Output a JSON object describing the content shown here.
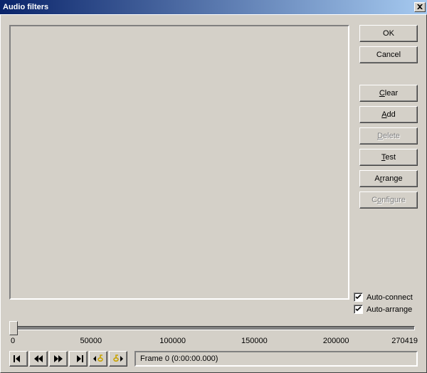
{
  "window": {
    "title": "Audio filters"
  },
  "buttons": {
    "ok": "OK",
    "cancel": "Cancel",
    "clear": "Clear",
    "add": "Add",
    "delete": "Delete",
    "test": "Test",
    "arrange": "Arrange",
    "configure": "Configure"
  },
  "checkboxes": {
    "auto_connect": {
      "label": "Auto-connect",
      "checked": true
    },
    "auto_arrange": {
      "label": "Auto-arrange",
      "checked": true
    }
  },
  "timeline": {
    "min": 0,
    "max": 270419,
    "ticks": [
      "0",
      "50000",
      "100000",
      "150000",
      "200000",
      "270419"
    ]
  },
  "frame_readout": "Frame 0 (0:00:00.000)"
}
